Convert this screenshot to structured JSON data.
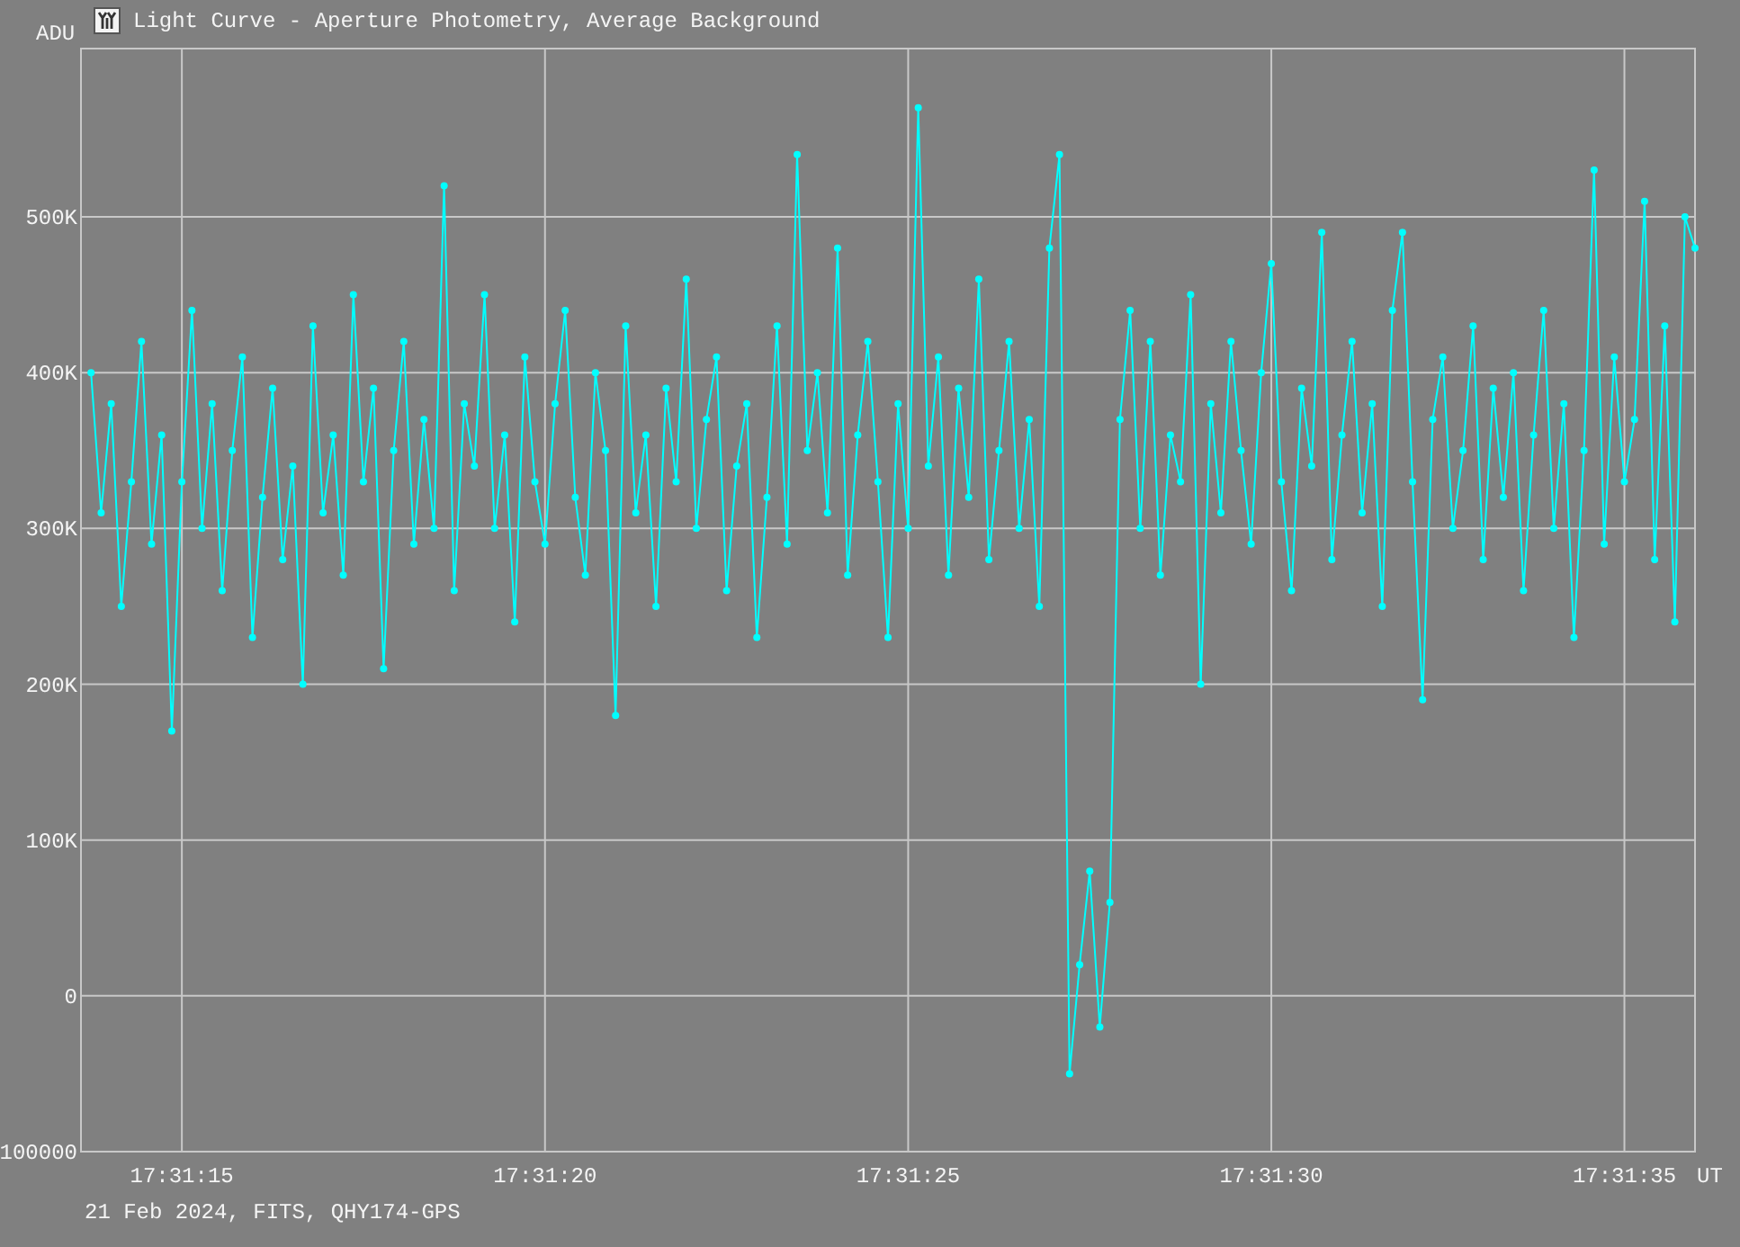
{
  "window": {
    "title": "Light Curve - Aperture Photometry, Average Background"
  },
  "chart_data": {
    "type": "line",
    "ylabel": "ADU",
    "grid": true,
    "ylim": [
      -100000,
      608000
    ],
    "categories": [
      null,
      null,
      null,
      null,
      null,
      null,
      null,
      null,
      null,
      "17:31:15",
      null,
      null,
      null,
      null,
      null,
      null,
      null,
      null,
      null,
      null,
      null,
      null,
      null,
      null,
      null,
      null,
      null,
      null,
      null,
      null,
      null,
      null,
      null,
      null,
      null,
      null,
      null,
      null,
      null,
      null,
      null,
      null,
      null,
      null,
      null,
      "17:31:20",
      null,
      null,
      null,
      null,
      null,
      null,
      null,
      null,
      null,
      null,
      null,
      null,
      null,
      null,
      null,
      null,
      null,
      null,
      null,
      null,
      null,
      null,
      null,
      null,
      null,
      null,
      null,
      null,
      null,
      null,
      null,
      null,
      null,
      null,
      null,
      "17:31:25",
      null,
      null,
      null,
      null,
      null,
      null,
      null,
      null,
      null,
      null,
      null,
      null,
      null,
      null,
      null,
      null,
      null,
      null,
      null,
      null,
      null,
      null,
      null,
      null,
      null,
      null,
      null,
      null,
      null,
      null,
      null,
      null,
      null,
      null,
      null,
      "17:31:30",
      null,
      null,
      null,
      null,
      null,
      null,
      null,
      null,
      null,
      null,
      null,
      null,
      null,
      null,
      null,
      null,
      null,
      null,
      null,
      null,
      null,
      null,
      null,
      null,
      null,
      null,
      null,
      null,
      null,
      null,
      null,
      null,
      null,
      null,
      "17:31:35",
      null,
      null,
      null,
      null,
      null,
      null,
      null
    ],
    "yticks": [
      {
        "value": 500000,
        "label": "500K"
      },
      {
        "value": 400000,
        "label": "400K"
      },
      {
        "value": 300000,
        "label": "300K"
      },
      {
        "value": 200000,
        "label": "200K"
      },
      {
        "value": 100000,
        "label": "100K"
      },
      {
        "value": 0,
        "label": "0"
      },
      {
        "value": -100000,
        "label": "100000"
      }
    ],
    "series": [
      {
        "color": "#00ffff",
        "marker": "circle",
        "values": [
          400000,
          310000,
          380000,
          250000,
          330000,
          420000,
          290000,
          360000,
          170000,
          330000,
          440000,
          300000,
          380000,
          260000,
          350000,
          410000,
          230000,
          320000,
          390000,
          280000,
          340000,
          200000,
          430000,
          310000,
          360000,
          270000,
          450000,
          330000,
          390000,
          210000,
          350000,
          420000,
          290000,
          370000,
          300000,
          520000,
          260000,
          380000,
          340000,
          450000,
          300000,
          360000,
          240000,
          410000,
          330000,
          290000,
          380000,
          440000,
          320000,
          270000,
          400000,
          350000,
          180000,
          430000,
          310000,
          360000,
          250000,
          390000,
          330000,
          460000,
          300000,
          370000,
          410000,
          260000,
          340000,
          380000,
          230000,
          320000,
          430000,
          290000,
          540000,
          350000,
          400000,
          310000,
          480000,
          270000,
          360000,
          420000,
          330000,
          230000,
          380000,
          300000,
          570000,
          340000,
          410000,
          270000,
          390000,
          320000,
          460000,
          280000,
          350000,
          420000,
          300000,
          370000,
          250000,
          480000,
          540000,
          -50000,
          20000,
          80000,
          -20000,
          60000,
          370000,
          440000,
          300000,
          420000,
          270000,
          360000,
          330000,
          450000,
          200000,
          380000,
          310000,
          420000,
          350000,
          290000,
          400000,
          470000,
          330000,
          260000,
          390000,
          340000,
          490000,
          280000,
          360000,
          420000,
          310000,
          380000,
          250000,
          440000,
          490000,
          330000,
          190000,
          370000,
          410000,
          300000,
          350000,
          430000,
          280000,
          390000,
          320000,
          400000,
          260000,
          360000,
          440000,
          300000,
          380000,
          230000,
          350000,
          530000,
          290000,
          410000,
          330000,
          370000,
          510000,
          280000,
          430000,
          240000,
          500000,
          480000
        ]
      }
    ]
  },
  "x_axis_unit": "UT",
  "footer": "21 Feb 2024, FITS, QHY174-GPS"
}
